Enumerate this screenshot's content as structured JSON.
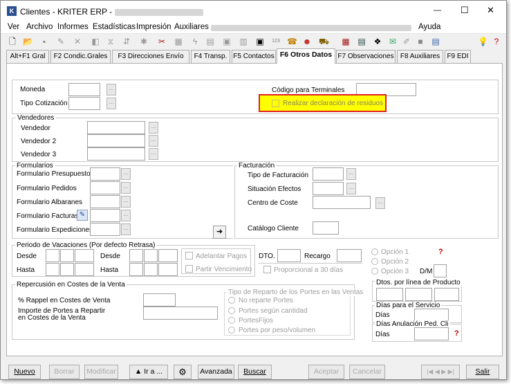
{
  "window": {
    "title": "Clientes - KRITER ERP -",
    "minimize": "—",
    "maximize": "☐",
    "close": "✕"
  },
  "menu": [
    "Ver",
    "Archivo",
    "Informes",
    "Estadísticas",
    "Impresión",
    "Auxiliares",
    "Ayuda"
  ],
  "tabs": [
    "Alt+F1 Gral",
    "F2 Condic.Grales",
    "F3 Direcciones Envío",
    "F4 Transp.",
    "F5 Contactos",
    "F6 Otros Datos",
    "F7 Observaciones",
    "F8 Auxiliares",
    "F9 EDI"
  ],
  "active_tab": "F6 Otros Datos",
  "general": {
    "moneda": "Moneda",
    "tipo_cotizacion": "Tipo Cotización",
    "codigo_terminales": "Código para Terminales",
    "declaracion_residuos": "Realizar declaración de residuos",
    "highlight_color": "#ffff00"
  },
  "vendedores": {
    "title": "Vendedores",
    "items": [
      "Vendedor",
      "Vendedor 2",
      "Vendedor 3"
    ]
  },
  "formularios": {
    "title": "Formularios",
    "items": [
      "Formulario Presupuestos",
      "Formulario Pedidos",
      "Formulario Albaranes",
      "Formulario Facturas",
      "Formulario Expediciones"
    ],
    "arrow": "➜"
  },
  "facturacion": {
    "title": "Facturación",
    "tipo": "Tipo de Facturación",
    "situacion": "Situación Efectos",
    "centro": "Centro de Coste",
    "catalogo": "Catálogo Cliente"
  },
  "vacaciones": {
    "title": "Periodo de Vacaciones (Por defecto Retrasa)",
    "desde": "Desde",
    "hasta": "Hasta",
    "adelantar": "Adelantar Pagos",
    "partir": "Partir Vencimiento",
    "dto": "DTO.",
    "recargo": "Recargo",
    "proporcional": "Proporcional a 30 días",
    "opciones": [
      "Opción 1",
      "Opción 2",
      "Opción 3"
    ],
    "dm": "D/M"
  },
  "repercusion": {
    "title": "Repercusión en Costes de la Venta",
    "rappel": "% Rappel en Costes de Venta",
    "importe_portes": "Importe de Portes a Repartir",
    "importe_portes_2": "en Costes de la Venta"
  },
  "reparto": {
    "title": "Tipo de Reparto de los Portes en las Ventas",
    "options": [
      "No reparte Portes",
      "Portes según cantidad",
      "PortesFijos",
      "Portes por peso/volumen"
    ]
  },
  "dtos": {
    "title": "Dtos. por línea de Producto",
    "servicio_title": "Días para el Servicio",
    "anulacion_title": "Días Anulación Ped. Cli",
    "dias": "Días"
  },
  "buttons": {
    "nuevo": "Nuevo",
    "borrar": "Borrar",
    "modificar": "Modificar",
    "ir_a": "▲ Ir a ...",
    "avanzada": "Avanzada",
    "buscar": "Buscar",
    "aceptar": "Aceptar",
    "cancelar": "Cancelar",
    "nav": "|◀ ◀ ▶ ▶|",
    "salir": "Salir"
  }
}
